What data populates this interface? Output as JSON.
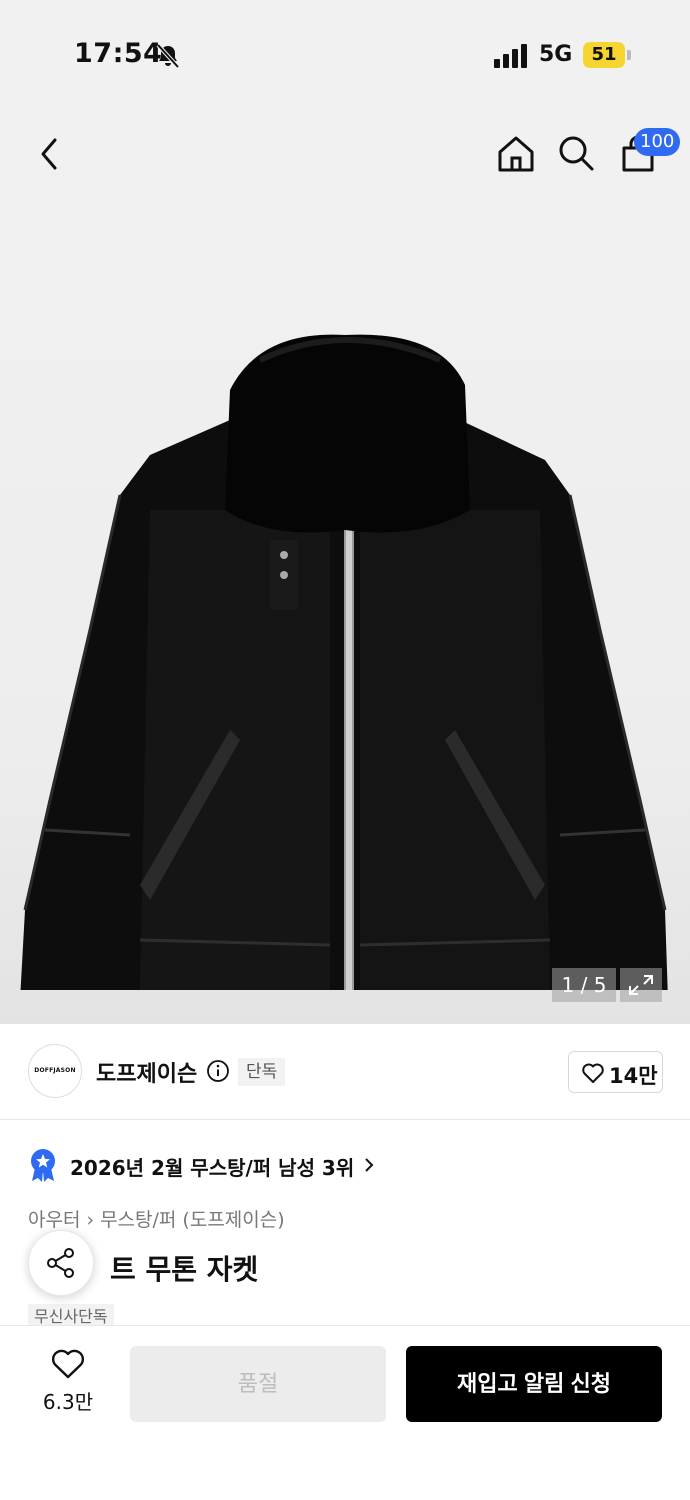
{
  "status_bar": {
    "time": "17:54",
    "network": "5G",
    "battery": "51"
  },
  "nav": {
    "cart_count": "100"
  },
  "gallery": {
    "counter": "1 / 5"
  },
  "brand": {
    "logo_text": "DOFFJASON",
    "name": "도프제이슨",
    "tag": "단독",
    "likes": "14만"
  },
  "ranking": {
    "text": "2026년 2월 무스탕/퍼 남성 3위"
  },
  "breadcrumb": {
    "category": "아우터",
    "subcategory": "무스탕/퍼 (도프제이슨)"
  },
  "product": {
    "title_visible": "트 무톤 자켓",
    "tag": "무신사단독"
  },
  "bottom_bar": {
    "wish_count": "6.3만",
    "soldout_label": "품절",
    "restock_label": "재입고 알림 신청"
  },
  "colors": {
    "accent_blue": "#2f6bf2",
    "battery_yellow": "#f6d531",
    "primary_button": "#000000",
    "disabled_button": "#ececec"
  },
  "icons": [
    "bell-off-icon",
    "signal-icon",
    "back-icon",
    "home-icon",
    "search-icon",
    "cart-icon",
    "expand-icon",
    "info-icon",
    "heart-icon",
    "medal-icon",
    "chevron-right-icon",
    "share-icon"
  ]
}
